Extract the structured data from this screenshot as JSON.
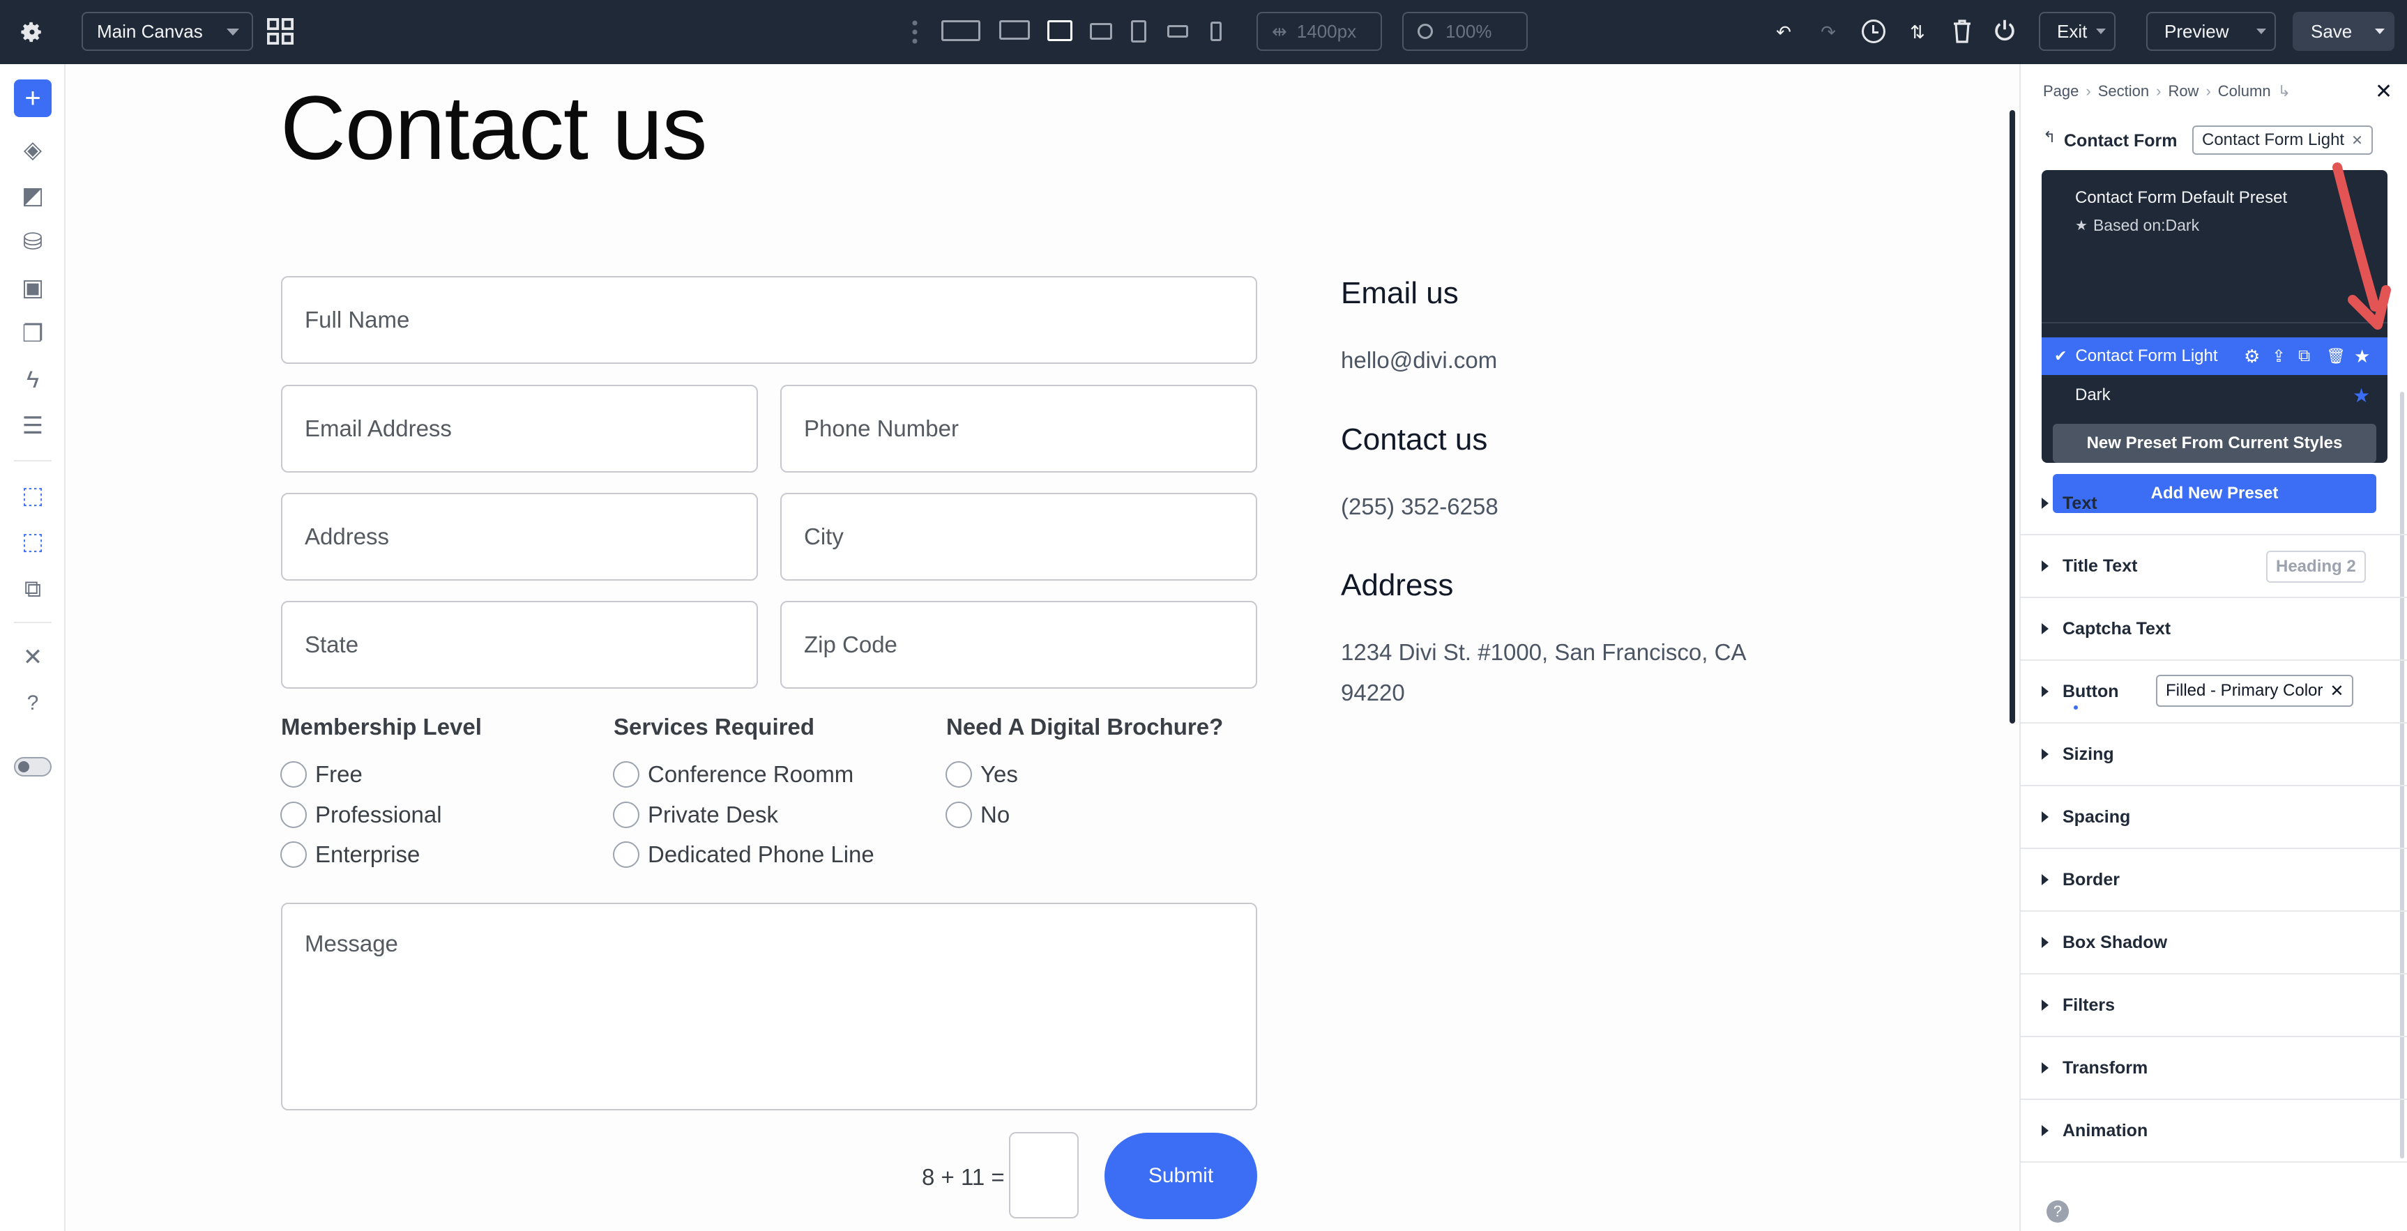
{
  "topbar": {
    "canvas_select": "Main Canvas",
    "width_value": "1400px",
    "zoom_value": "100%",
    "exit_label": "Exit",
    "preview_label": "Preview",
    "save_label": "Save"
  },
  "page": {
    "title": "Contact us"
  },
  "form": {
    "full_name": "Full Name",
    "email": "Email Address",
    "phone": "Phone Number",
    "address": "Address",
    "city": "City",
    "state": "State",
    "zip": "Zip Code",
    "message": "Message",
    "membership": {
      "heading": "Membership Level",
      "options": [
        "Free",
        "Professional",
        "Enterprise"
      ]
    },
    "services": {
      "heading": "Services Required",
      "options": [
        "Conference Roomm",
        "Private Desk",
        "Dedicated Phone Line"
      ]
    },
    "brochure": {
      "heading": "Need A Digital Brochure?",
      "options": [
        "Yes",
        "No"
      ]
    },
    "captcha": "8 + 11 =",
    "submit": "Submit"
  },
  "info": {
    "email_heading": "Email us",
    "email_value": "hello@divi.com",
    "phone_heading": "Contact us",
    "phone_value": "(255) 352-6258",
    "address_heading": "Address",
    "address_line1": "1234 Divi St. #1000, San Francisco, CA",
    "address_line2": "94220"
  },
  "panel": {
    "breadcrumb": [
      "Page",
      "Section",
      "Row",
      "Column"
    ],
    "module_name": "Contact Form",
    "preset_chip": "Contact Form Light",
    "dropdown": {
      "default_title": "Contact Form Default Preset",
      "based_on": "Based on:Dark",
      "selected": "Contact Form Light",
      "other": "Dark",
      "new_from_current": "New Preset From Current Styles",
      "add_new": "Add New Preset"
    },
    "sections": {
      "text": "Text",
      "title_text": "Title Text",
      "title_chip": "Heading 2",
      "captcha_text": "Captcha Text",
      "button": "Button",
      "button_chip": "Filled - Primary Color",
      "sizing": "Sizing",
      "spacing": "Spacing",
      "border": "Border",
      "box_shadow": "Box Shadow",
      "filters": "Filters",
      "transform": "Transform",
      "animation": "Animation"
    }
  },
  "colors": {
    "accent": "#3b6ef5",
    "topbar": "#1f2937",
    "arrow": "#e35454"
  }
}
